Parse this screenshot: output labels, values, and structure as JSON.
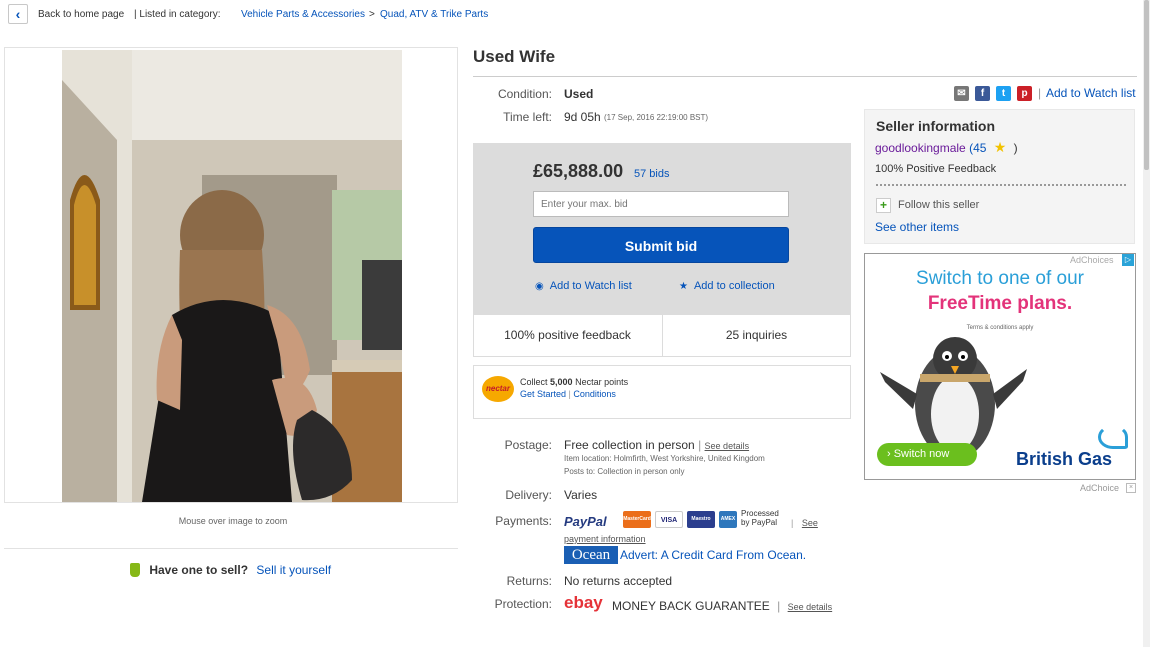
{
  "breadcrumb": {
    "back_label": "Back to home page",
    "listed_in": "| Listed in category:",
    "cat1": "Vehicle Parts & Accessories",
    "sep": ">",
    "cat2": "Quad, ATV & Trike Parts"
  },
  "gallery": {
    "zoom_note": "Mouse over image to zoom"
  },
  "sell": {
    "question": "Have one to sell?",
    "link": "Sell it yourself"
  },
  "item": {
    "title": "Used Wife",
    "condition_label": "Condition:",
    "condition_value": "Used",
    "time_left_label": "Time left:",
    "time_left_value": "9d 05h",
    "time_left_detail": "(17 Sep, 2016   22:19:00 BST)"
  },
  "share": {
    "add_watch": "Add to Watch list",
    "sep": "|"
  },
  "bid": {
    "price": "£65,888.00",
    "bids": "57 bids",
    "input_placeholder": "Enter your max. bid",
    "submit": "Submit bid",
    "watch_link": "Add to Watch list",
    "collection_link": "Add to collection",
    "feedback": "100% positive feedback",
    "inquiries": "25 inquiries"
  },
  "nectar": {
    "logo": "nectar",
    "collect_pre": "Collect",
    "points": "5,000",
    "collect_post": "Nectar points",
    "get_started": "Get Started",
    "sep": "|",
    "conditions": "Conditions"
  },
  "shipping": {
    "postage_label": "Postage:",
    "postage_value": "Free collection in person",
    "sep": "|",
    "see_details": "See details",
    "item_location": "Item location:  Holmfirth, West Yorkshire, United Kingdom",
    "posts_to": "Posts to:  Collection in person only",
    "delivery_label": "Delivery:",
    "delivery_value": "Varies",
    "payments_label": "Payments:",
    "paypal": "PayPal",
    "card_mc": "MasterCard",
    "card_visa": "VISA",
    "card_maestro": "Maestro",
    "card_amex": "AMEX",
    "processed": "Processed",
    "by_paypal": "by PayPal",
    "see": "See",
    "payment_info": "payment information",
    "ocean_logo": "Ocean",
    "ocean_advert": "Advert: A Credit Card From Ocean.",
    "returns_label": "Returns:",
    "returns_value": "No returns accepted",
    "protection_label": "Protection:",
    "ebay_logo": "ebay",
    "money_back": "MONEY BACK GUARANTEE",
    "see_details2": "See details"
  },
  "seller": {
    "title": "Seller information",
    "name": "goodlookingmale",
    "score": "(45",
    "score_close": ")",
    "feedback": "100% Positive Feedback",
    "follow": "Follow this seller",
    "other_items": "See other items"
  },
  "ad": {
    "adchoices_top": "AdChoices",
    "line1": "Switch to one of our",
    "line2": "FreeTime plans.",
    "terms": "Terms & conditions apply",
    "button": "› Switch now",
    "brand": "British Gas",
    "adchoice_bottom": "AdChoice"
  },
  "colors": {
    "link": "#0654ba",
    "submit": "#0654ba",
    "seller_name": "#6a1b9a",
    "ad_blue": "#2a9fd8",
    "ad_pink": "#e3337a"
  }
}
